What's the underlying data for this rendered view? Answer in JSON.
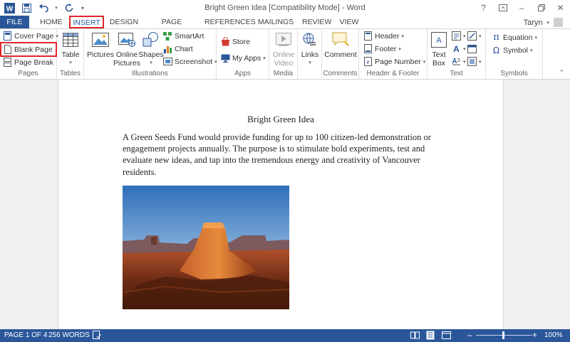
{
  "window": {
    "title": "Bright Green Idea [Compatibility Mode] - Word",
    "help": "?",
    "minimize": "–",
    "close": "✕"
  },
  "tabs": [
    {
      "label": "FILE"
    },
    {
      "label": "HOME"
    },
    {
      "label": "INSERT"
    },
    {
      "label": "DESIGN"
    },
    {
      "label": "PAGE LAYOUT"
    },
    {
      "label": "REFERENCES"
    },
    {
      "label": "MAILINGS"
    },
    {
      "label": "REVIEW"
    },
    {
      "label": "VIEW"
    }
  ],
  "user": {
    "name": "Taryn"
  },
  "ribbon": {
    "pages": {
      "label": "Pages",
      "cover": "Cover Page",
      "blank": "Blank Page",
      "break": "Page Break"
    },
    "tables": {
      "label": "Tables",
      "table": "Table"
    },
    "illustrations": {
      "label": "Illustrations",
      "pictures": "Pictures",
      "online1": "Online",
      "online2": "Pictures",
      "shapes": "Shapes",
      "smartart": "SmartArt",
      "chart": "Chart",
      "screenshot": "Screenshot"
    },
    "apps": {
      "label": "Apps",
      "store": "Store",
      "myapps": "My Apps"
    },
    "media": {
      "label": "Media",
      "online1": "Online",
      "online2": "Video"
    },
    "links": {
      "label": "",
      "links": "Links"
    },
    "comments": {
      "label": "Comments",
      "comment": "Comment"
    },
    "hf": {
      "label": "Header & Footer",
      "header": "Header",
      "footer": "Footer",
      "pagenum": "Page Number"
    },
    "text": {
      "label": "Text",
      "text1": "Text",
      "text2": "Box"
    },
    "symbols": {
      "label": "Symbols",
      "equation": "Equation",
      "symbol": "Symbol"
    }
  },
  "document": {
    "title": "Bright Green Idea",
    "paragraph": "A Green Seeds Fund would provide funding for up to 100 citizen-led demonstration or engagement projects annually. The purpose is to stimulate bold experiments, test and evaluate new ideas, and tap into the tremendous energy and creativity of Vancouver residents."
  },
  "status": {
    "page": "PAGE 1 OF 4",
    "words": "256 WORDS",
    "zoom_minus": "–",
    "zoom_plus": "+",
    "zoom": "100%"
  },
  "colors": {
    "accent": "#2b579a",
    "highlight": "#e0262d"
  }
}
